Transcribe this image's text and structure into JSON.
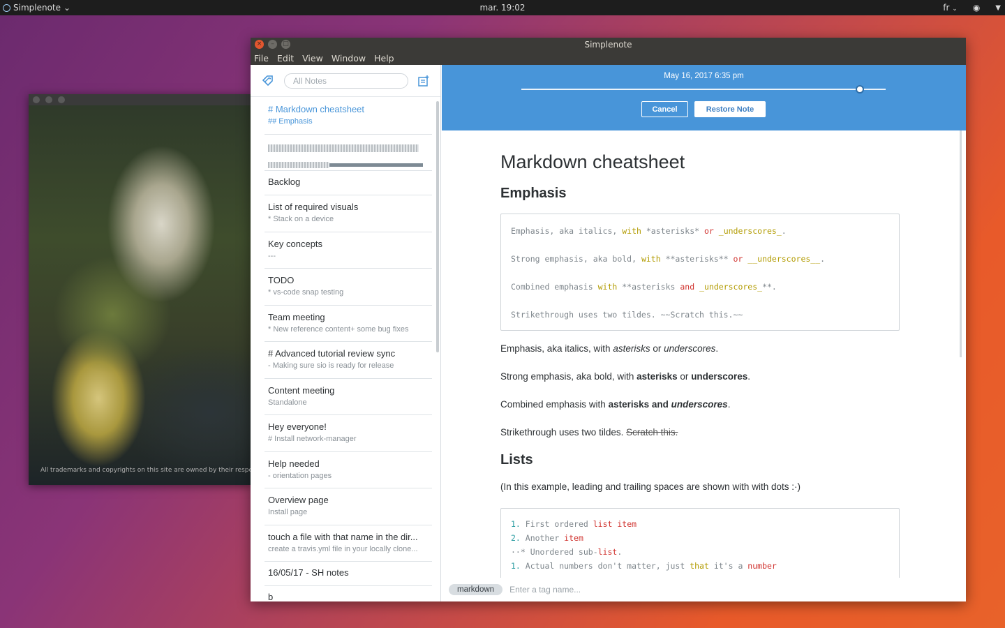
{
  "top_panel": {
    "app_name": "Simplenote",
    "clock": "mar. 19:02",
    "language": "fr"
  },
  "bg_window": {
    "caption": "All trademarks and copyrights on this site are owned by their respective o"
  },
  "window": {
    "title": "Simplenote",
    "menu": [
      "File",
      "Edit",
      "View",
      "Window",
      "Help"
    ]
  },
  "sidebar": {
    "search_placeholder": "All Notes",
    "notes": [
      {
        "title": "# Markdown cheatsheet",
        "preview": "## Emphasis",
        "selected": true
      },
      {
        "title": "",
        "preview": "",
        "loading": true
      },
      {
        "title": "Backlog",
        "preview": ""
      },
      {
        "title": "List of required visuals",
        "preview": "* Stack on a device"
      },
      {
        "title": "Key concepts",
        "preview": "---"
      },
      {
        "title": "TODO",
        "preview": "* vs-code snap testing"
      },
      {
        "title": "Team meeting",
        "preview": "* New reference content+ some bug fixes"
      },
      {
        "title": "# Advanced tutorial review sync",
        "preview": "- Making sure sio is ready for release"
      },
      {
        "title": "Content meeting",
        "preview": "Standalone"
      },
      {
        "title": "Hey everyone!",
        "preview": "# Install network-manager"
      },
      {
        "title": "Help needed",
        "preview": "- orientation pages"
      },
      {
        "title": "Overview page",
        "preview": "Install page"
      },
      {
        "title": "touch a file with that name in the dir...",
        "preview": "create a travis.yml file in your locally clone..."
      },
      {
        "title": "16/05/17 - SH notes",
        "preview": ""
      },
      {
        "title": "b",
        "preview": ""
      }
    ]
  },
  "history": {
    "date": "May 16, 2017 6:35 pm",
    "slider_position": 0.93,
    "cancel_label": "Cancel",
    "restore_label": "Restore Note"
  },
  "document": {
    "h1": "Markdown cheatsheet",
    "h2_emphasis": "Emphasis",
    "code1": {
      "l1": [
        "Emphasis, aka italics, ",
        "with",
        " *asterisks* ",
        "or",
        " ",
        "_underscores_",
        "."
      ],
      "l2": [
        "Strong emphasis, aka bold, ",
        "with",
        " **asterisks** ",
        "or",
        " ",
        "__underscores__",
        "."
      ],
      "l3": [
        "Combined emphasis ",
        "with",
        " **asterisks ",
        "and",
        " ",
        "_underscores_",
        "**."
      ],
      "l4": [
        "Strikethrough uses two tildes. ~~Scratch this.~~"
      ]
    },
    "p1": [
      "Emphasis, aka italics, with ",
      "asterisks",
      " or ",
      "underscores",
      "."
    ],
    "p2": [
      "Strong emphasis, aka bold, with ",
      "asterisks",
      " or ",
      "underscores",
      "."
    ],
    "p3": [
      "Combined emphasis with ",
      "asterisks and ",
      "underscores",
      "."
    ],
    "p4": [
      "Strikethrough uses two tildes. ",
      "Scratch this."
    ],
    "h2_lists": "Lists",
    "p5": "(In this example, leading and trailing spaces are shown with with dots :·)",
    "code2": {
      "l1": [
        "1.",
        " First ordered ",
        "list",
        " ",
        "item"
      ],
      "l2": [
        "2.",
        " Another ",
        "item"
      ],
      "l3": [
        "··* Unordered sub-",
        "list",
        "."
      ],
      "l4": [
        "1.",
        " Actual numbers don't matter, just ",
        "that",
        " it",
        "'s a ",
        "number"
      ]
    }
  },
  "tags": {
    "chip": "markdown",
    "input_placeholder": "Enter a tag name..."
  },
  "colors": {
    "accent": "#4895d9",
    "code_yellow": "#b29b00",
    "code_red": "#d0322e",
    "code_teal": "#2e9ea3"
  }
}
